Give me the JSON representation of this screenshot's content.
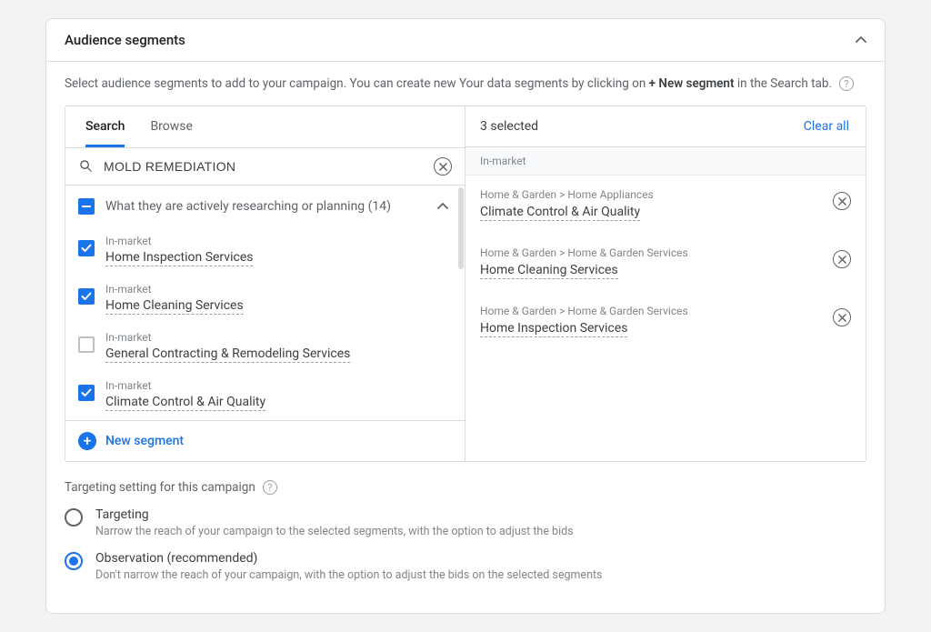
{
  "header": {
    "title": "Audience segments"
  },
  "helper": {
    "pre": "Select audience segments to add to your campaign. You can create new Your data segments by clicking on ",
    "bold": "+ New segment",
    "post": " in the Search tab."
  },
  "tabs": {
    "search": "Search",
    "browse": "Browse"
  },
  "search": {
    "value": "MOLD REMEDIATION"
  },
  "group": {
    "label": "What they are actively researching or planning (14)"
  },
  "meta": {
    "inmarket": "In-market"
  },
  "results": [
    {
      "meta": "In-market",
      "title": "Home Inspection Services",
      "checked": true
    },
    {
      "meta": "In-market",
      "title": "Home Cleaning Services",
      "checked": true
    },
    {
      "meta": "In-market",
      "title": "General Contracting & Remodeling Services",
      "checked": false
    },
    {
      "meta": "In-market",
      "title": "Climate Control & Air Quality",
      "checked": true
    }
  ],
  "newSegment": "New segment",
  "selected": {
    "count": "3 selected",
    "clear": "Clear all",
    "section": "In-market",
    "items": [
      {
        "breadcrumb": "Home & Garden > Home Appliances",
        "title": "Climate Control & Air Quality"
      },
      {
        "breadcrumb": "Home & Garden > Home & Garden Services",
        "title": "Home Cleaning Services"
      },
      {
        "breadcrumb": "Home & Garden > Home & Garden Services",
        "title": "Home Inspection Services"
      }
    ]
  },
  "targeting": {
    "title": "Targeting setting for this campaign",
    "option1": {
      "label": "Targeting",
      "desc": "Narrow the reach of your campaign to the selected segments, with the option to adjust the bids"
    },
    "option2": {
      "label": "Observation (recommended)",
      "desc": "Don't narrow the reach of your campaign, with the option to adjust the bids on the selected segments"
    }
  }
}
